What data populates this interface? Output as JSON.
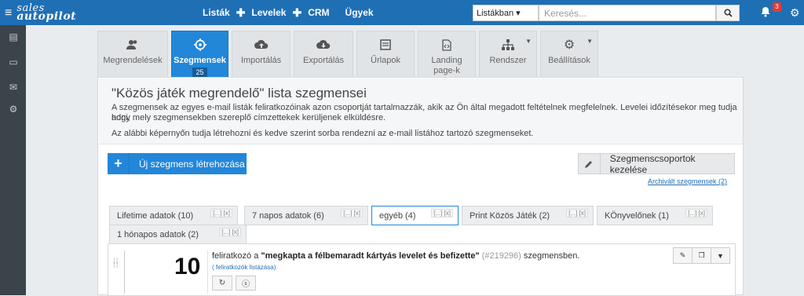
{
  "brand": {
    "line1": "sales",
    "line2": "autopilot"
  },
  "topnav": {
    "items": [
      "Listák",
      "Levelek",
      "CRM",
      "Ügyek"
    ]
  },
  "search": {
    "scope": "Listákban ▾",
    "placeholder": "Keresés..."
  },
  "notifications": {
    "count": "3"
  },
  "tabs": [
    {
      "label": "Megrendelések",
      "icon": "users-icon"
    },
    {
      "label": "Szegmensek",
      "count": "25",
      "icon": "target-icon"
    },
    {
      "label": "Importálás",
      "icon": "cloud-upload-icon"
    },
    {
      "label": "Exportálás",
      "icon": "cloud-download-icon"
    },
    {
      "label": "Űrlapok",
      "icon": "form-icon"
    },
    {
      "label": "Landing page-k",
      "icon": "code-file-icon"
    },
    {
      "label": "Rendszer",
      "icon": "sitemap-icon"
    },
    {
      "label": "Beállítások",
      "icon": "gear-icon"
    }
  ],
  "header": {
    "title": "\"Közös játék megrendelő\" lista szegmensei",
    "p1": "A szegmensek az egyes e-mail listák feliratkozóinak azon csoportját tartalmazzák, akik az Ön által megadott feltételnek megfelelnek. Levelei időzítésekor meg tudja adni,",
    "p2": "hogy mely szegmensekben szereplő címzettekek kerüljenek elküldésre.",
    "p3": "Az alábbi képernyőn tudja létrehozni és kedve szerint sorba rendezni az e-mail listához tartozó szegmenseket."
  },
  "actions": {
    "new_segment": "Új szegmens létrehozása",
    "manage_groups": "Szegmenscsoportok kezelése",
    "archived": "Archivált szegmensek (2)"
  },
  "segment_tabs": [
    {
      "label": "Lifetime adatok (10)",
      "x": "[...] [x]"
    },
    {
      "label": "7 napos adatok (6)",
      "x": "[...] [x]"
    },
    {
      "label": "egyéb (4)",
      "x": "[...] [x]",
      "active": true
    },
    {
      "label": "Print Közös Játék (2)",
      "x": "[...] [x]"
    },
    {
      "label": "KÖnyvelőnek (1)",
      "x": "[...] [x]"
    },
    {
      "label": "1 hónapos adatok (2)",
      "x": "[...] [x]"
    }
  ],
  "segment": {
    "count": "10",
    "prefix": "feliratkozó a",
    "name": "\"megkapta a félbemaradt kártyás levelet és befizette\"",
    "id": "(#219296)",
    "suffix": "szegmensben.",
    "list_link": "( feliratkozók listázása)"
  }
}
